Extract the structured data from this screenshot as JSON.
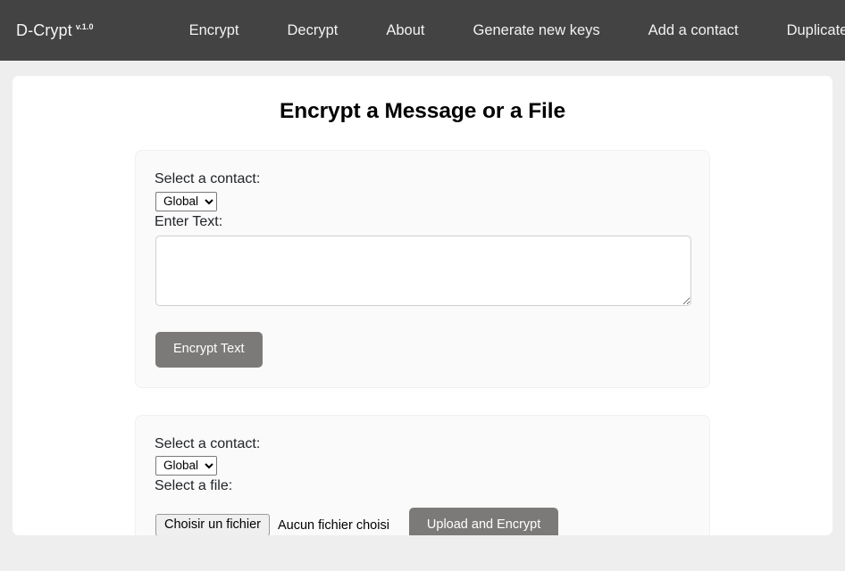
{
  "navbar": {
    "brand": "D-Crypt",
    "brand_version": "v.1.0",
    "links": [
      {
        "label": "Encrypt"
      },
      {
        "label": "Decrypt"
      },
      {
        "label": "About"
      },
      {
        "label": "Generate new keys"
      },
      {
        "label": "Add a contact"
      },
      {
        "label": "Duplicate D-Crypt"
      }
    ]
  },
  "main": {
    "title": "Encrypt a Message or a File",
    "text_card": {
      "contact_label": "Select a contact:",
      "contact_selected": "Global",
      "contact_options": [
        "Global"
      ],
      "text_label": "Enter Text:",
      "text_value": "",
      "text_placeholder": "",
      "submit_label": "Encrypt Text"
    },
    "file_card": {
      "contact_label": "Select a contact:",
      "contact_selected": "Global",
      "contact_options": [
        "Global"
      ],
      "file_label": "Select a file:",
      "file_button_label": "Choisir un fichier",
      "file_status": "Aucun fichier choisi",
      "submit_label": "Upload and Encrypt"
    }
  },
  "colors": {
    "navbar_bg": "#434343",
    "page_bg": "#eeeeee",
    "container_bg": "#ffffff",
    "card_bg": "#fafafa",
    "button_bg": "#7c7a78",
    "button_text": "#ffffff"
  }
}
